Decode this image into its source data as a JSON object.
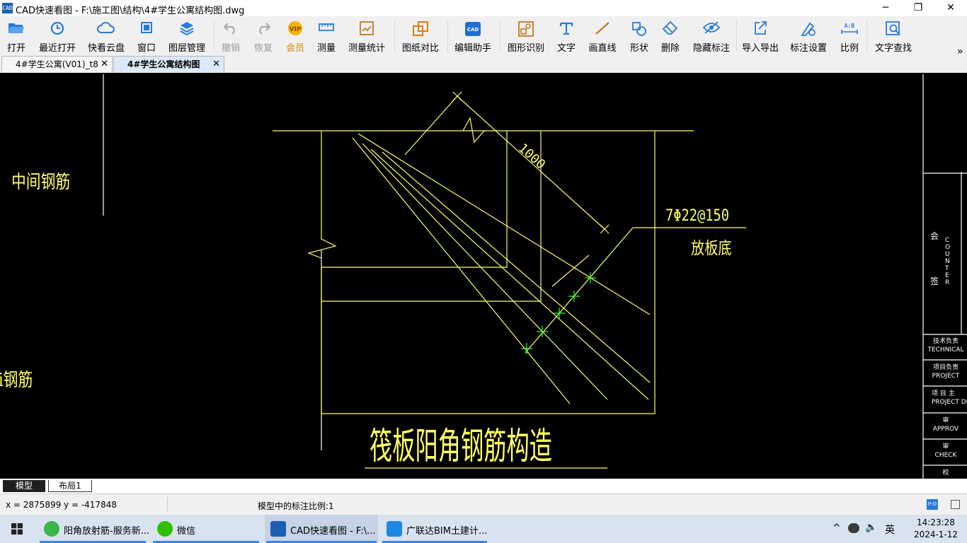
{
  "window": {
    "title": "CAD快速看图 - F:\\施工图\\结构\\4#学生公寓结构图.dwg",
    "app_logo_text": "CAD",
    "controls": {
      "minimize": "─",
      "restore": "❐",
      "close": "✕"
    }
  },
  "toolbar": {
    "items": [
      {
        "label": "打开",
        "icon": "folder-open-icon"
      },
      {
        "label": "最近打开",
        "icon": "history-icon"
      },
      {
        "label": "快看云盘",
        "icon": "cloud-icon"
      },
      {
        "label": "窗口",
        "icon": "window-icon"
      },
      {
        "label": "图层管理",
        "icon": "layers-icon"
      },
      {
        "label": "撤销",
        "icon": "undo-icon"
      },
      {
        "label": "恢复",
        "icon": "redo-icon"
      },
      {
        "label": "会员",
        "icon": "vip-icon"
      },
      {
        "label": "测量",
        "icon": "ruler-icon"
      },
      {
        "label": "测量统计",
        "icon": "measure-stats-icon"
      },
      {
        "label": "图纸对比",
        "icon": "compare-icon"
      },
      {
        "label": "编辑助手",
        "icon": "edit-assistant-icon"
      },
      {
        "label": "图形识别",
        "icon": "shape-recognition-icon"
      },
      {
        "label": "文字",
        "icon": "text-icon"
      },
      {
        "label": "画直线",
        "icon": "line-icon"
      },
      {
        "label": "形状",
        "icon": "shape-icon"
      },
      {
        "label": "删除",
        "icon": "eraser-icon"
      },
      {
        "label": "隐藏标注",
        "icon": "eye-hidden-icon"
      },
      {
        "label": "导入导出",
        "icon": "import-export-icon"
      },
      {
        "label": "标注设置",
        "icon": "annotation-settings-icon"
      },
      {
        "label": "比例",
        "icon": "scale-icon"
      },
      {
        "label": "文字查找",
        "icon": "text-search-icon"
      }
    ],
    "more": "»",
    "vip_badge": "VIP",
    "scale_badge": "A:B",
    "edit_badge": "CAD"
  },
  "tabs": [
    {
      "label": "4#学生公寓(V01)_t8",
      "close": "✕"
    },
    {
      "label": "4#学生公寓结构图",
      "close": "✕"
    }
  ],
  "drawing": {
    "labels": {
      "middle_rebar": "中间钢筋",
      "middle_rebar_partial": "i钢筋",
      "dimension": "1000",
      "rebar_spec": "7Φ22@150",
      "placement": "放板底",
      "title": "筏板阳角钢筋构造"
    },
    "title_block": {
      "counter_text": "C O U N T E R",
      "countersign_1": "会",
      "countersign_2": "签",
      "rows": [
        {
          "cn": "技术负责",
          "en": "TECHNICAL"
        },
        {
          "cn": "项目负责",
          "en": "PROJECT"
        },
        {
          "cn": "项 目 主",
          "en": "PROJECT DI"
        },
        {
          "cn": "审",
          "en": "APPROV"
        },
        {
          "cn": "审",
          "en": "CHECK"
        },
        {
          "cn": "校",
          "en": ""
        }
      ]
    },
    "colors": {
      "background": "#000000",
      "lines": "#ffff66",
      "white_lines": "#ffffff",
      "markers": "#00ff00"
    }
  },
  "layout_tabs": [
    {
      "label": "模型"
    },
    {
      "label": "布局1"
    }
  ],
  "status": {
    "coordinates": "x = 2875899  y = -417848",
    "scale_text": "模型中的标注比例:1",
    "badge": "P-D"
  },
  "taskbar": {
    "items": [
      {
        "label": "阳角放射筋-服务新...",
        "icon": "browser-icon"
      },
      {
        "label": "微信",
        "icon": "wechat-icon"
      },
      {
        "label": "CAD快速看图 - F:\\...",
        "icon": "cad-icon"
      },
      {
        "label": "广联达BIM土建计...",
        "icon": "glodon-icon"
      }
    ],
    "tray": {
      "chevron": "^",
      "ime": "英",
      "speaker": "🔈"
    },
    "time": "14:23:28",
    "date": "2024-1-12"
  }
}
